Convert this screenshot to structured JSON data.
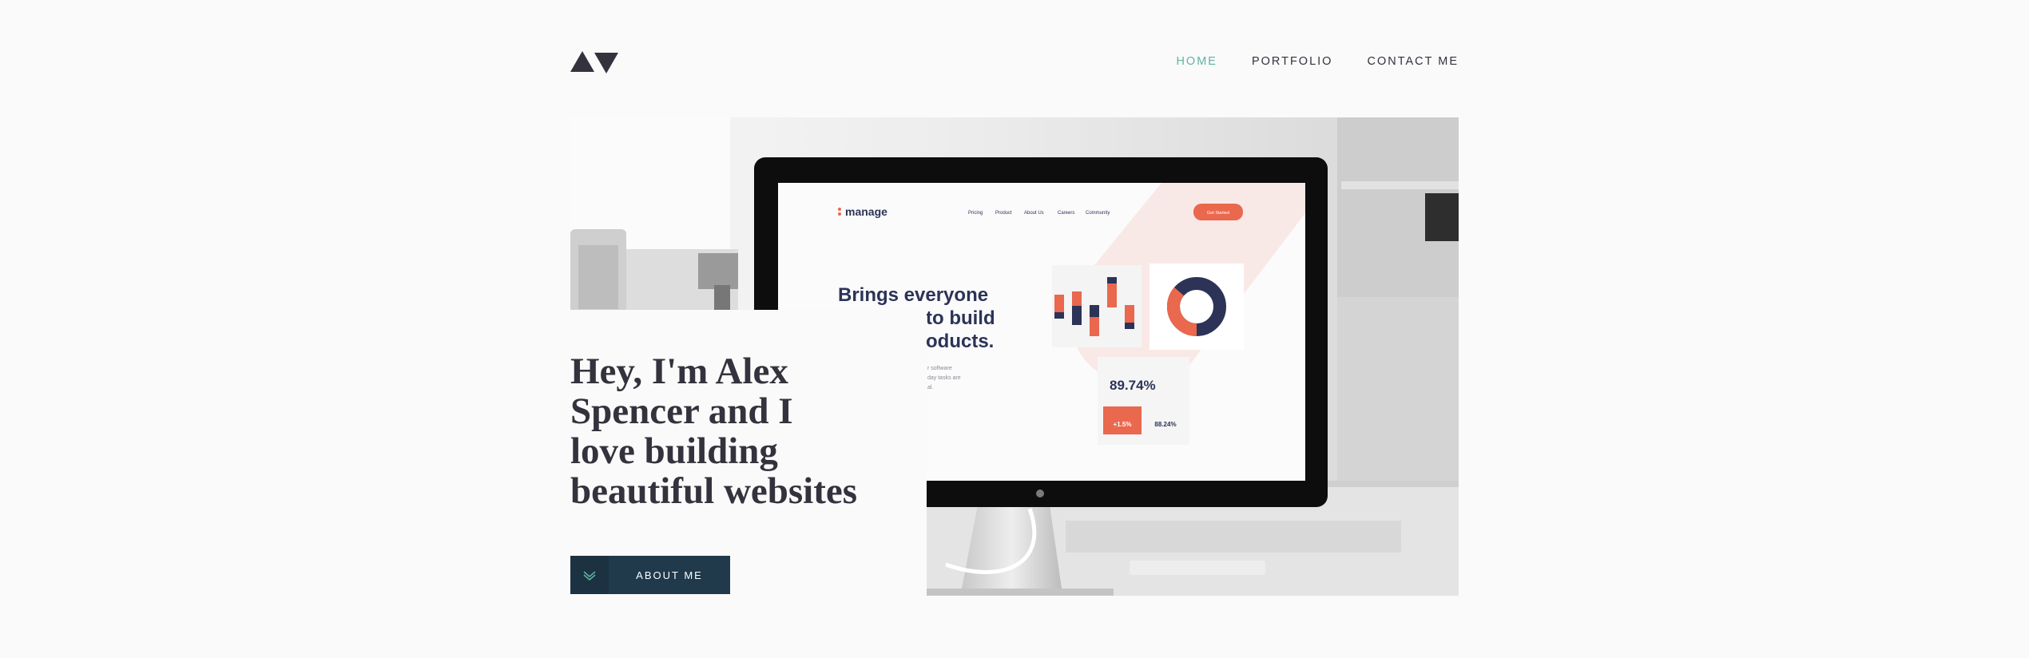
{
  "header": {
    "logo_icon": "alex-spencer-triangles-logo",
    "nav": [
      {
        "label": "HOME",
        "active": true
      },
      {
        "label": "PORTFOLIO",
        "active": false
      },
      {
        "label": "CONTACT ME",
        "active": false
      }
    ]
  },
  "hero": {
    "mockup": {
      "brand": "manage",
      "menu": [
        "Pricing",
        "Product",
        "About Us",
        "Careers",
        "Community"
      ],
      "cta": "Get Started",
      "headline_lines": [
        "Brings everyone",
        "to build",
        "oducts."
      ],
      "body_fragments": [
        "r software",
        "day tasks are",
        "al."
      ],
      "stat_main": "89.74%",
      "stat_delta": "+1.5%",
      "stat_secondary": "88.24%"
    }
  },
  "intro": {
    "title_lines": [
      "Hey, I'm Alex",
      "Spencer and I",
      "love building",
      "beautiful websites"
    ],
    "button_label": "ABOUT ME",
    "button_icon": "double-chevron-down-icon"
  },
  "colors": {
    "background": "#fafafa",
    "text_dark": "#33323d",
    "accent_teal": "#5fb4a2",
    "button_navy": "#203a4c",
    "mockup_orange": "#e9684e",
    "mockup_navy": "#2c3357"
  }
}
